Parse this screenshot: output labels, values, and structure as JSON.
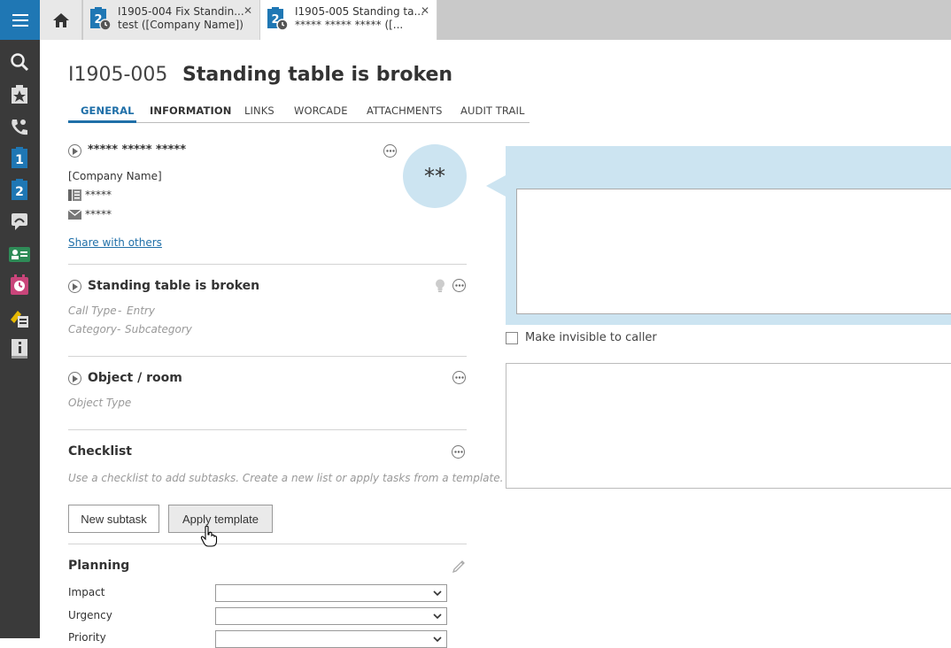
{
  "nav": {
    "items": [
      {
        "icon": "menu-icon"
      },
      {
        "icon": "search-icon"
      },
      {
        "icon": "star-ticket-icon"
      },
      {
        "icon": "phone-icon"
      },
      {
        "icon": "ticket-1-icon"
      },
      {
        "icon": "ticket-2-icon"
      },
      {
        "icon": "chat-icon"
      },
      {
        "icon": "contact-card-icon"
      },
      {
        "icon": "alarm-clock-icon"
      },
      {
        "icon": "rocket-list-icon"
      },
      {
        "icon": "info-book-icon"
      }
    ],
    "colors": {
      "bg": "#3a3a3a",
      "menu": "#1f77b4",
      "ticket_blue": "#1f77b4",
      "ticket_green": "#2e8b57"
    }
  },
  "tabs_bar": {
    "tabs": [
      {
        "line1": "I1905-004 Fix Standin...",
        "line2": "test ([Company Name])",
        "close": "✕",
        "badge": "2"
      },
      {
        "line1": "I1905-005 Standing ta...",
        "line2": "***** ***** ***** ([...",
        "close": "✕",
        "badge": "2"
      }
    ]
  },
  "header": {
    "ticket_id": "I1905-005",
    "ticket_title": "Standing table is broken"
  },
  "page_tabs": [
    "GENERAL",
    "INFORMATION",
    "LINKS",
    "WORCADE",
    "ATTACHMENTS",
    "AUDIT TRAIL"
  ],
  "caller": {
    "name": "***** ***** *****",
    "company": "[Company Name]",
    "phone": "*****",
    "email": "*****",
    "share_link": "Share with others",
    "avatar_initials": "**"
  },
  "summary": {
    "title": "Standing table is broken",
    "call_type": "Call Type",
    "entry": "Entry",
    "category": "Category",
    "subcategory": "Subcategory",
    "separator": "-"
  },
  "object": {
    "title": "Object / room",
    "object_type": "Object Type"
  },
  "checklist": {
    "title": "Checklist",
    "hint": "Use a checklist to add subtasks. Create a new list or apply tasks from a template.",
    "new_subtask": "New subtask",
    "apply_template": "Apply template"
  },
  "planning": {
    "title": "Planning",
    "fields": [
      {
        "label": "Impact",
        "value": ""
      },
      {
        "label": "Urgency",
        "value": ""
      },
      {
        "label": "Priority",
        "value": ""
      }
    ]
  },
  "right": {
    "make_invisible_label": "Make invisible to caller",
    "bubble_color": "#cce4f1"
  }
}
